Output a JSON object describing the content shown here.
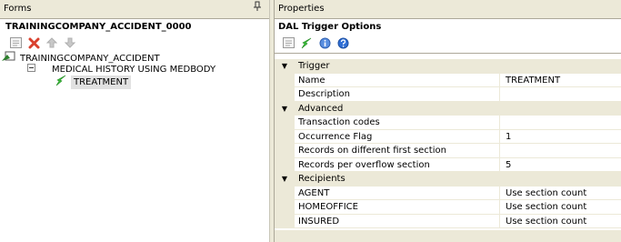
{
  "forms_pane": {
    "title": "Forms",
    "pin_icon": "pin-icon",
    "form_name": "TRAININGCOMPANY_ACCIDENT_0000",
    "toolbar": [
      "properties-icon",
      "delete-icon",
      "move-up-icon",
      "move-down-icon"
    ],
    "tree": {
      "root_label": "TRAININGCOMPANY_ACCIDENT",
      "child_label": "MEDICAL HISTORY USING MEDBODY",
      "selected_label": "TREATMENT"
    }
  },
  "properties_pane": {
    "title": "Properties",
    "heading": "DAL Trigger Options",
    "toolbar": [
      "categorized-icon",
      "trigger-icon",
      "info-icon",
      "help-icon"
    ],
    "categories": [
      {
        "label": "Trigger",
        "rows": [
          {
            "name": "Name",
            "value": "TREATMENT"
          },
          {
            "name": "Description",
            "value": ""
          }
        ]
      },
      {
        "label": "Advanced",
        "rows": [
          {
            "name": "Transaction codes",
            "value": ""
          },
          {
            "name": "Occurrence Flag",
            "value": "1"
          },
          {
            "name": "Records on different first section",
            "value": ""
          },
          {
            "name": "Records per overflow section",
            "value": "5"
          }
        ]
      },
      {
        "label": "Recipients",
        "rows": [
          {
            "name": "AGENT",
            "value": "Use section count"
          },
          {
            "name": "HOMEOFFICE",
            "value": "Use section count"
          },
          {
            "name": "INSURED",
            "value": "Use section count"
          }
        ]
      }
    ]
  },
  "colors": {
    "chrome": "#ece9d8",
    "border": "#aca899",
    "selection": "#e1e1e1",
    "delete_red": "#d9412e",
    "trigger_green": "#3cc43c",
    "info_blue": "#2f6fd6"
  }
}
